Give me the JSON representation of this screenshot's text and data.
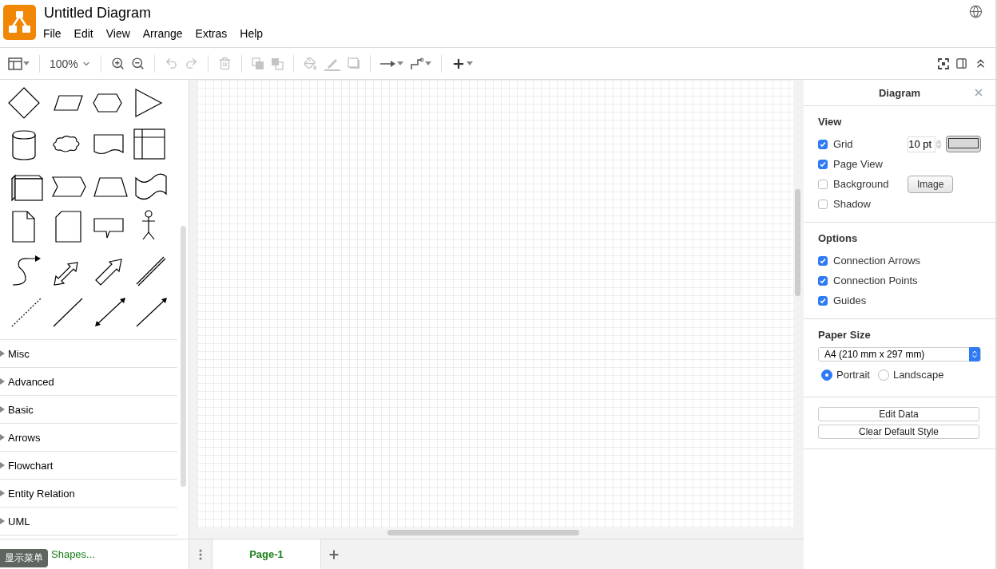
{
  "app": {
    "title": "Untitled Diagram"
  },
  "menu": [
    "File",
    "Edit",
    "View",
    "Arrange",
    "Extras",
    "Help"
  ],
  "zoom": "100%",
  "toolbar": [
    {
      "kind": "layout",
      "disabled": false
    },
    {
      "kind": "sep"
    },
    {
      "kind": "zoom"
    },
    {
      "kind": "sep"
    },
    {
      "kind": "zoomin",
      "disabled": false
    },
    {
      "kind": "zoomout",
      "disabled": false
    },
    {
      "kind": "sep"
    },
    {
      "kind": "undo",
      "disabled": true
    },
    {
      "kind": "redo",
      "disabled": true
    },
    {
      "kind": "sep"
    },
    {
      "kind": "delete",
      "disabled": true
    },
    {
      "kind": "sep"
    },
    {
      "kind": "front",
      "disabled": true
    },
    {
      "kind": "back",
      "disabled": true
    },
    {
      "kind": "sep"
    },
    {
      "kind": "fill",
      "disabled": true
    },
    {
      "kind": "line",
      "disabled": true
    },
    {
      "kind": "shadow",
      "disabled": true
    },
    {
      "kind": "sep"
    },
    {
      "kind": "connection",
      "disabled": false
    },
    {
      "kind": "waypoints",
      "disabled": false
    },
    {
      "kind": "sep"
    },
    {
      "kind": "insert",
      "disabled": false
    }
  ],
  "categories": [
    {
      "label": "Misc",
      "expanded": false
    },
    {
      "label": "Advanced",
      "expanded": false
    },
    {
      "label": "Basic",
      "expanded": false
    },
    {
      "label": "Arrows",
      "expanded": false
    },
    {
      "label": "Flowchart",
      "expanded": false
    },
    {
      "label": "Entity Relation",
      "expanded": false
    },
    {
      "label": "UML",
      "expanded": false
    }
  ],
  "more_shapes": "Shapes...",
  "tooltip": "显示菜单",
  "pages": [
    {
      "label": "Page-1",
      "selected": true
    }
  ],
  "format_panel": {
    "title": "Diagram",
    "sections": [
      {
        "heading": "View",
        "options": [
          {
            "kind": "grid",
            "label": "Grid",
            "checked": true,
            "value": "10 pt"
          },
          {
            "kind": "plain",
            "label": "Page View",
            "checked": true
          },
          {
            "kind": "image",
            "label": "Background",
            "checked": false,
            "button": "Image"
          },
          {
            "kind": "plain",
            "label": "Shadow",
            "checked": false
          }
        ]
      },
      {
        "heading": "Options",
        "options": [
          {
            "kind": "plain",
            "label": "Connection Arrows",
            "checked": true
          },
          {
            "kind": "plain",
            "label": "Connection Points",
            "checked": true
          },
          {
            "kind": "plain",
            "label": "Guides",
            "checked": true
          }
        ]
      }
    ],
    "paper": {
      "heading": "Paper Size",
      "value": "A4 (210 mm x 297 mm)",
      "orientations": [
        {
          "label": "Portrait",
          "selected": true
        },
        {
          "label": "Landscape",
          "selected": false
        }
      ]
    },
    "buttons": [
      "Edit Data",
      "Clear Default Style"
    ]
  }
}
